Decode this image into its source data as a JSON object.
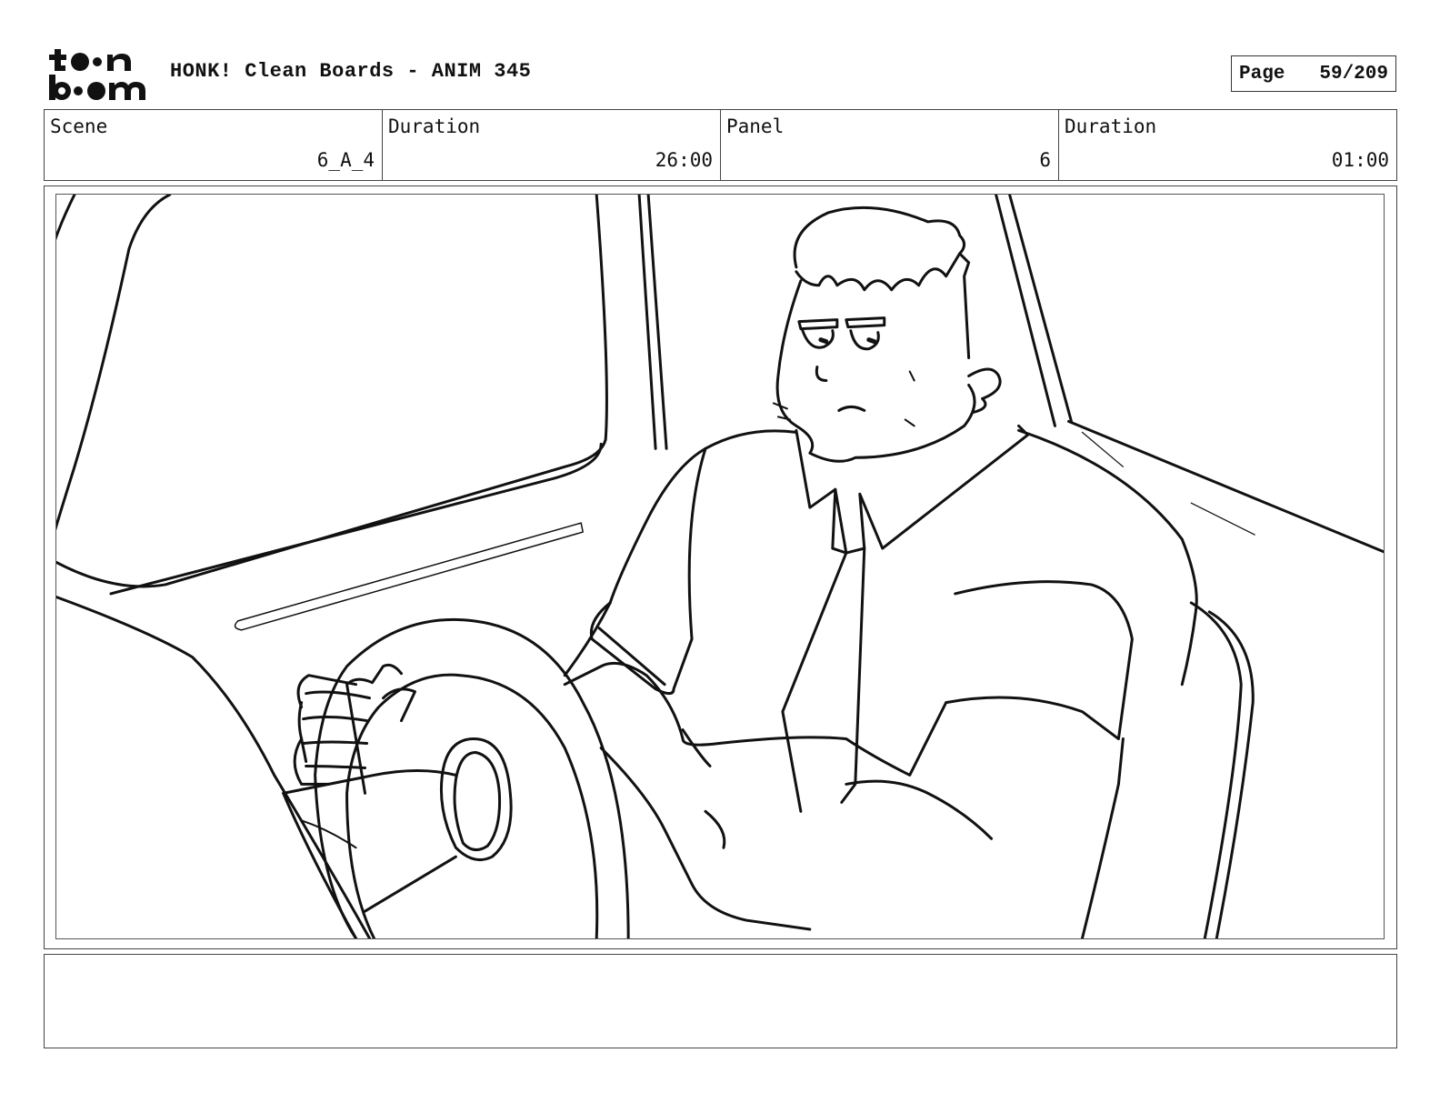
{
  "header": {
    "logo_top": "t●●n",
    "logo_bottom": "b●●m",
    "title": "HONK! Clean Boards - ANIM 345",
    "page_label": "Page",
    "page_value": "59/209"
  },
  "info": {
    "scene_label": "Scene",
    "scene_value": "6_A_4",
    "scene_duration_label": "Duration",
    "scene_duration_value": "26:00",
    "panel_label": "Panel",
    "panel_value": "6",
    "panel_duration_label": "Duration",
    "panel_duration_value": "01:00"
  },
  "notes": {
    "text": ""
  }
}
